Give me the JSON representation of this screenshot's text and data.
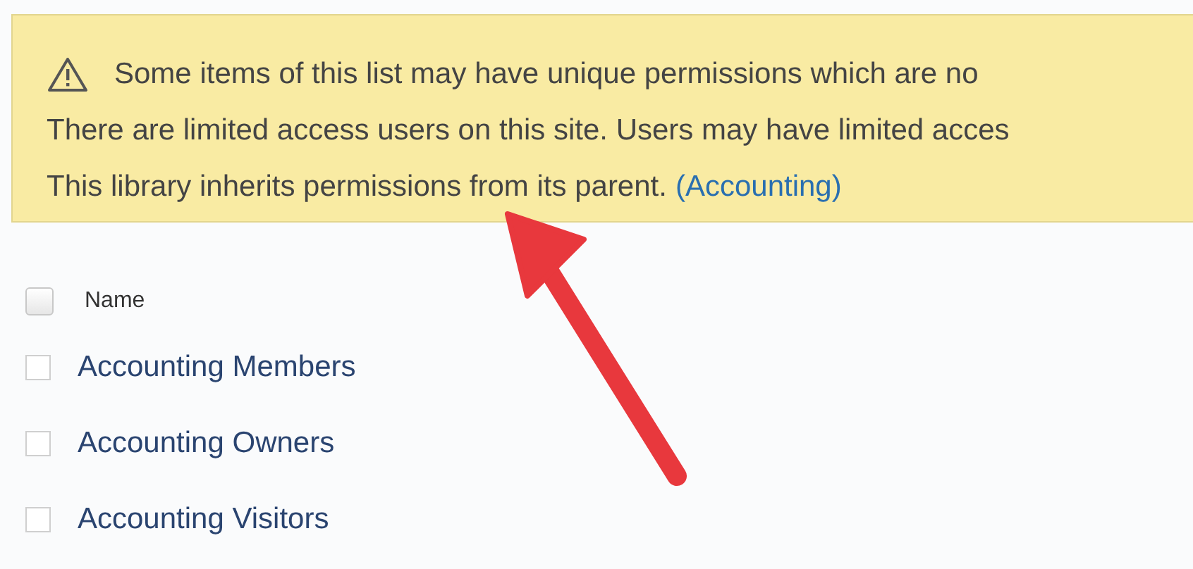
{
  "notice": {
    "lines": [
      {
        "text": "Some items of this list may have unique permissions which are no"
      },
      {
        "text": "There are limited access users on this site. Users may have limited acces"
      },
      {
        "text": "This library inherits permissions from its parent.",
        "link": "(Accounting)"
      }
    ]
  },
  "list": {
    "header": {
      "label": "Name",
      "checked": false
    },
    "rows": [
      {
        "name": "Accounting Members",
        "checked": false
      },
      {
        "name": "Accounting Owners",
        "checked": false
      },
      {
        "name": "Accounting Visitors",
        "checked": false
      }
    ]
  }
}
